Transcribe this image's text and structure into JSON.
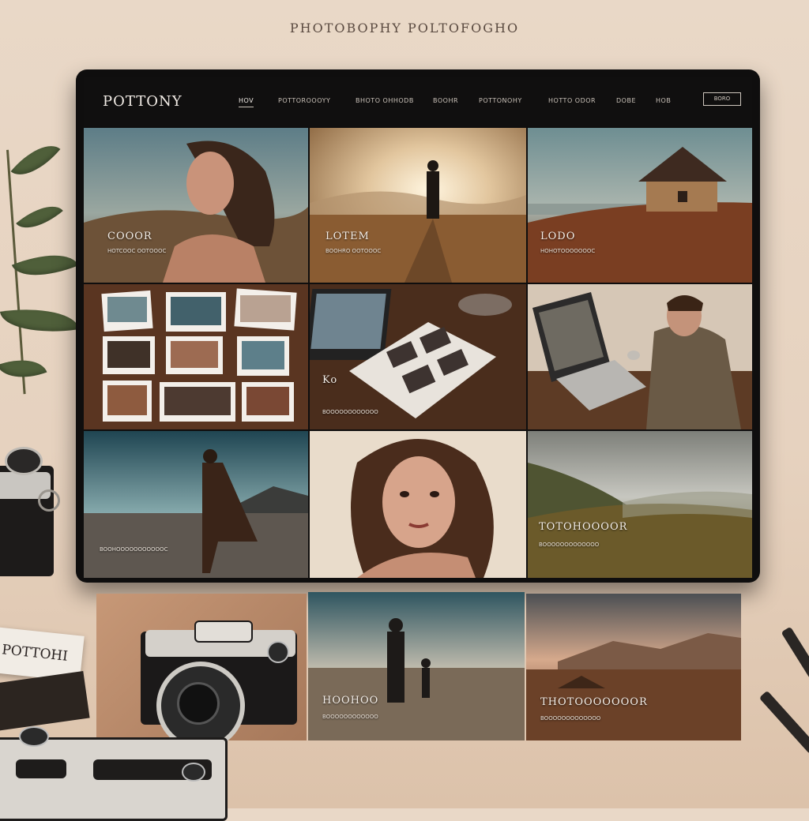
{
  "page": {
    "heading": "PHOTOBOPHY POLTOFOGHO"
  },
  "navbar": {
    "brand": "POTTONY",
    "items": [
      "HOV",
      "POTTOROOOYY",
      "BHOTO OHHODB",
      "BOOHR",
      "POTTONOHY",
      "HOTTO ODOR",
      "DOBE",
      "HOB"
    ],
    "active_index": 0,
    "cta": "BORO"
  },
  "grid": {
    "row1": [
      {
        "title": "COOOR",
        "subtitle": "HOTCOOC OOTOOOC"
      },
      {
        "title": "LOTEM",
        "subtitle": "BOOHRO OOTOOOC"
      },
      {
        "title": "LODO",
        "subtitle": "HOHOTOOOOOOOC"
      }
    ],
    "row2": [
      {
        "title": "",
        "subtitle": ""
      },
      {
        "title": "Ko",
        "subtitle": "BOOOOOOOOOOOO"
      },
      {
        "title": "",
        "subtitle": ""
      }
    ],
    "row3": [
      {
        "title": "",
        "subtitle": "BOOHOOOOOOOOOOOC"
      },
      {
        "title": "",
        "subtitle": ""
      },
      {
        "title": "TOTOHOOOOR",
        "subtitle": "BOOOOOOOOOOOOO"
      }
    ],
    "row4": [
      {
        "title": "",
        "subtitle": ""
      },
      {
        "title": "HOOHOO",
        "subtitle": "BOOOOOOOOOOOO"
      },
      {
        "title": "THOTOOOOOOOR",
        "subtitle": "BOOOOOOOOOOOOO"
      }
    ]
  },
  "desk": {
    "note_text": "POTTOHI"
  },
  "colors": {
    "accent": "#c9c1b8",
    "monitor_bg": "#0f0e0e",
    "desk": "#e6d2bf"
  }
}
